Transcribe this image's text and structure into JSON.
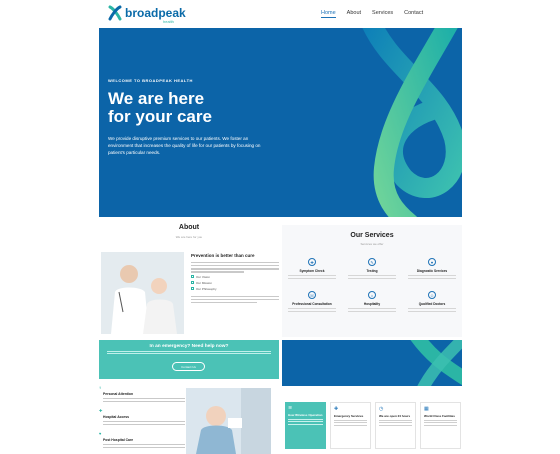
{
  "nav": {
    "brand": "broadpeak",
    "brand_sub": "health",
    "links": [
      "Home",
      "About",
      "Services",
      "Contact"
    ]
  },
  "hero": {
    "tag": "WELCOME TO BROADPEAK HEALTH",
    "title_line1": "We are here",
    "title_line2": "for your care",
    "text": "We provide disruptive premium services to our patients. We foster an environment that increases the quality of life for our patients by focusing on patient's particular needs."
  },
  "about": {
    "title": "About",
    "subtitle": "We are here for you",
    "heading": "Prevention is better than cure",
    "checks": [
      "Our Vision",
      "Our Mission",
      "Our Philosophy"
    ]
  },
  "services": {
    "title": "Our Services",
    "subtitle": "Services we offer",
    "items": [
      "Symptom Check",
      "Testing",
      "Diagnostic Services",
      "Professional Consultation",
      "Hospitality",
      "Qualified Doctors"
    ]
  },
  "emergency": {
    "title": "In an emergency? Need help now?",
    "button": "Contact Us"
  },
  "features": [
    "Personal Attention",
    "Hospital Access",
    "Post Hospital Care"
  ],
  "cards": [
    "How Wireless Operation",
    "Emergency Services",
    "We are open 24 hours",
    "World Class Facilities"
  ],
  "colors": {
    "primary": "#0c64a8",
    "accent": "#4bc2b6",
    "link_active": "#1f73b7"
  }
}
